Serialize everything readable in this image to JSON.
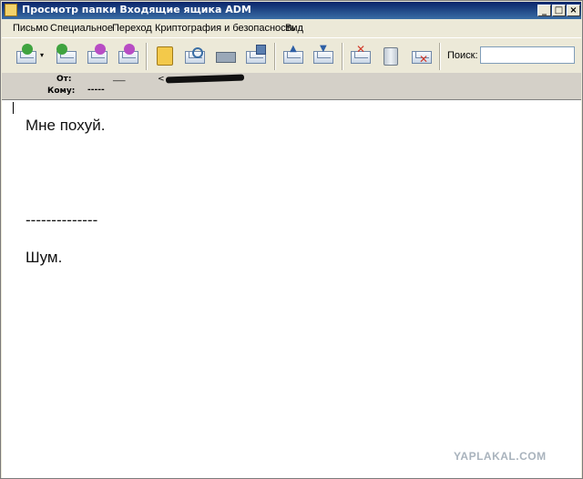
{
  "window": {
    "title": "Просмотр папки Входящие ящика ADM",
    "buttons": {
      "minimize": "_",
      "maximize": "□",
      "close": "×"
    }
  },
  "menu": {
    "items": [
      "Письмо",
      "Специальное",
      "Переход",
      "Криптография и безопасность",
      "Вид"
    ]
  },
  "toolbar": {
    "search_label": "Поиск:",
    "search_value": ""
  },
  "headers": {
    "from_label": "От:",
    "from_value": "___",
    "from_email_prefix": "<",
    "to_label": "Кому:",
    "to_value": "-----"
  },
  "message": {
    "lines": [
      "Мне похуй.",
      "--------------",
      "Шум."
    ]
  },
  "watermark": {
    "text": "YAPLAKAL.COM"
  },
  "colors": {
    "title_start": "#0a246a",
    "title_end": "#3a6ea5",
    "chrome": "#ece9d8"
  }
}
